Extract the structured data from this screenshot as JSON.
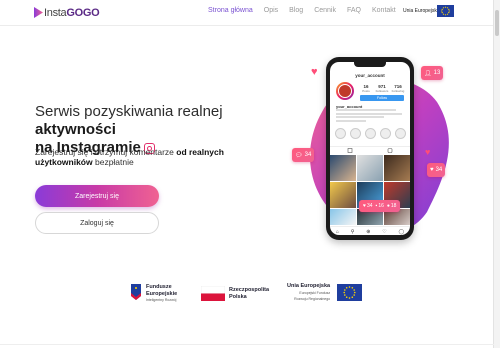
{
  "brand": {
    "logo_text_part1": "Insta",
    "logo_text_part2": "GOGO"
  },
  "nav": {
    "items": [
      {
        "label": "Strona główna",
        "active": true
      },
      {
        "label": "Opis",
        "active": false
      },
      {
        "label": "Blog",
        "active": false
      },
      {
        "label": "Cennik",
        "active": false
      },
      {
        "label": "FAQ",
        "active": false
      },
      {
        "label": "Kontakt",
        "active": false
      }
    ],
    "eu_label": "Unia Europejska"
  },
  "hero": {
    "title_part1": "Serwis pozyskiwania realnej ",
    "title_bold1": "aktywności",
    "title_bold2": "na Instagramie",
    "subtitle_part1": "Zarejestruj się i otrzymuj komentarze ",
    "subtitle_bold1": "od realnych",
    "subtitle_bold2": "użytkowników",
    "subtitle_part2": " bezpłatnie",
    "register_label": "Zarejestruj się",
    "login_label": "Zaloguj się"
  },
  "phone": {
    "account": "your_account",
    "posts": "16",
    "followers": "971",
    "following": "716",
    "posts_label": "Posts",
    "followers_label": "Followers",
    "following_label": "Following",
    "follow_label": "Follow",
    "username": "your_account"
  },
  "badges": {
    "top_right": "13",
    "left": "34",
    "right": "34",
    "grid_likes": "34",
    "grid_comments": "16",
    "grid_follows": "18"
  },
  "funds": {
    "fe_title1": "Fundusze",
    "fe_title2": "Europejskie",
    "fe_sub": "Inteligentny Rozwój",
    "rp_title1": "Rzeczpospolita",
    "rp_title2": "Polska",
    "ue_title": "Unia Europejska",
    "ue_sub1": "Europejski Fundusz",
    "ue_sub2": "Rozwoju Regionalnego"
  },
  "colors": {
    "accent": "#7a52d1",
    "gradient_start": "#8a3bd8",
    "gradient_end": "#f06292",
    "badge": "#ff5a7d",
    "eu_blue": "#1f3e9e",
    "poland_red": "#dc143c"
  }
}
